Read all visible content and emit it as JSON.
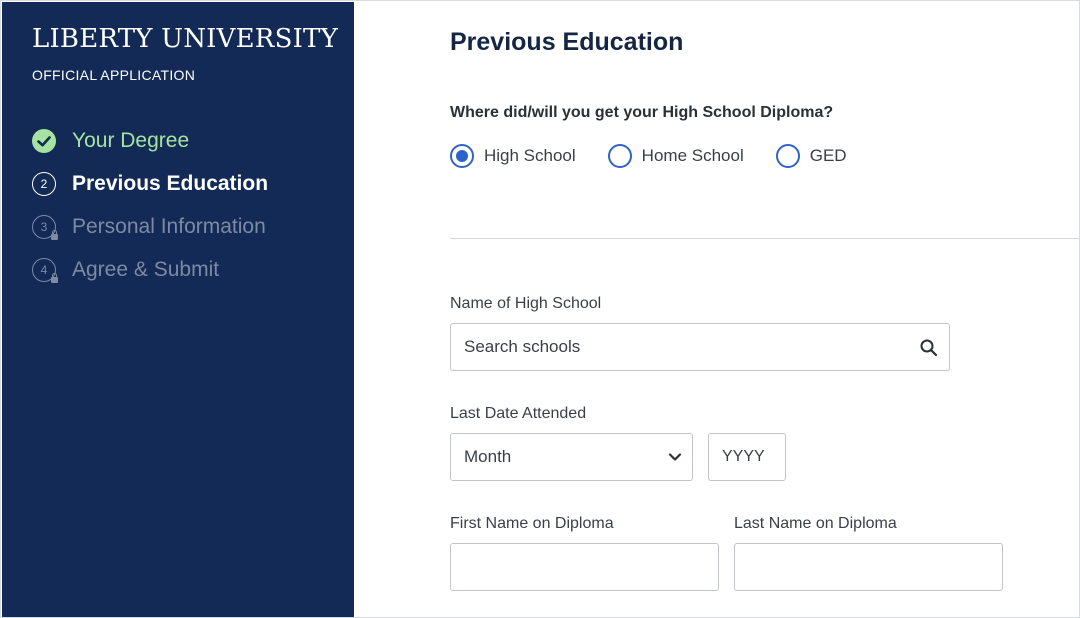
{
  "sidebar": {
    "brand": "LIBERTY UNIVERSITY",
    "subtitle": "OFFICIAL APPLICATION",
    "steps": [
      {
        "number": "",
        "label": "Your Degree",
        "state": "completed"
      },
      {
        "number": "2",
        "label": "Previous Education",
        "state": "active"
      },
      {
        "number": "3",
        "label": "Personal Information",
        "state": "locked"
      },
      {
        "number": "4",
        "label": "Agree & Submit",
        "state": "locked"
      }
    ]
  },
  "main": {
    "title": "Previous Education",
    "diploma_question": "Where did/will you get your High School Diploma?",
    "diploma_options": [
      {
        "label": "High School",
        "selected": true
      },
      {
        "label": "Home School",
        "selected": false
      },
      {
        "label": "GED",
        "selected": false
      }
    ],
    "school_name": {
      "label": "Name of High School",
      "placeholder": "Search schools",
      "value": ""
    },
    "last_date": {
      "label": "Last Date Attended",
      "month_value": "Month",
      "year_placeholder": "YYYY"
    },
    "first_name": {
      "label": "First Name on Diploma",
      "value": ""
    },
    "last_name": {
      "label": "Last Name on Diploma",
      "value": ""
    }
  },
  "colors": {
    "sidebar_bg": "#122a55",
    "completed_green": "#a6e3a1",
    "radio_blue": "#2f62c9",
    "title_navy": "#152544"
  },
  "icons": [
    "check-icon",
    "lock-icon",
    "search-icon",
    "chevron-down-icon"
  ]
}
